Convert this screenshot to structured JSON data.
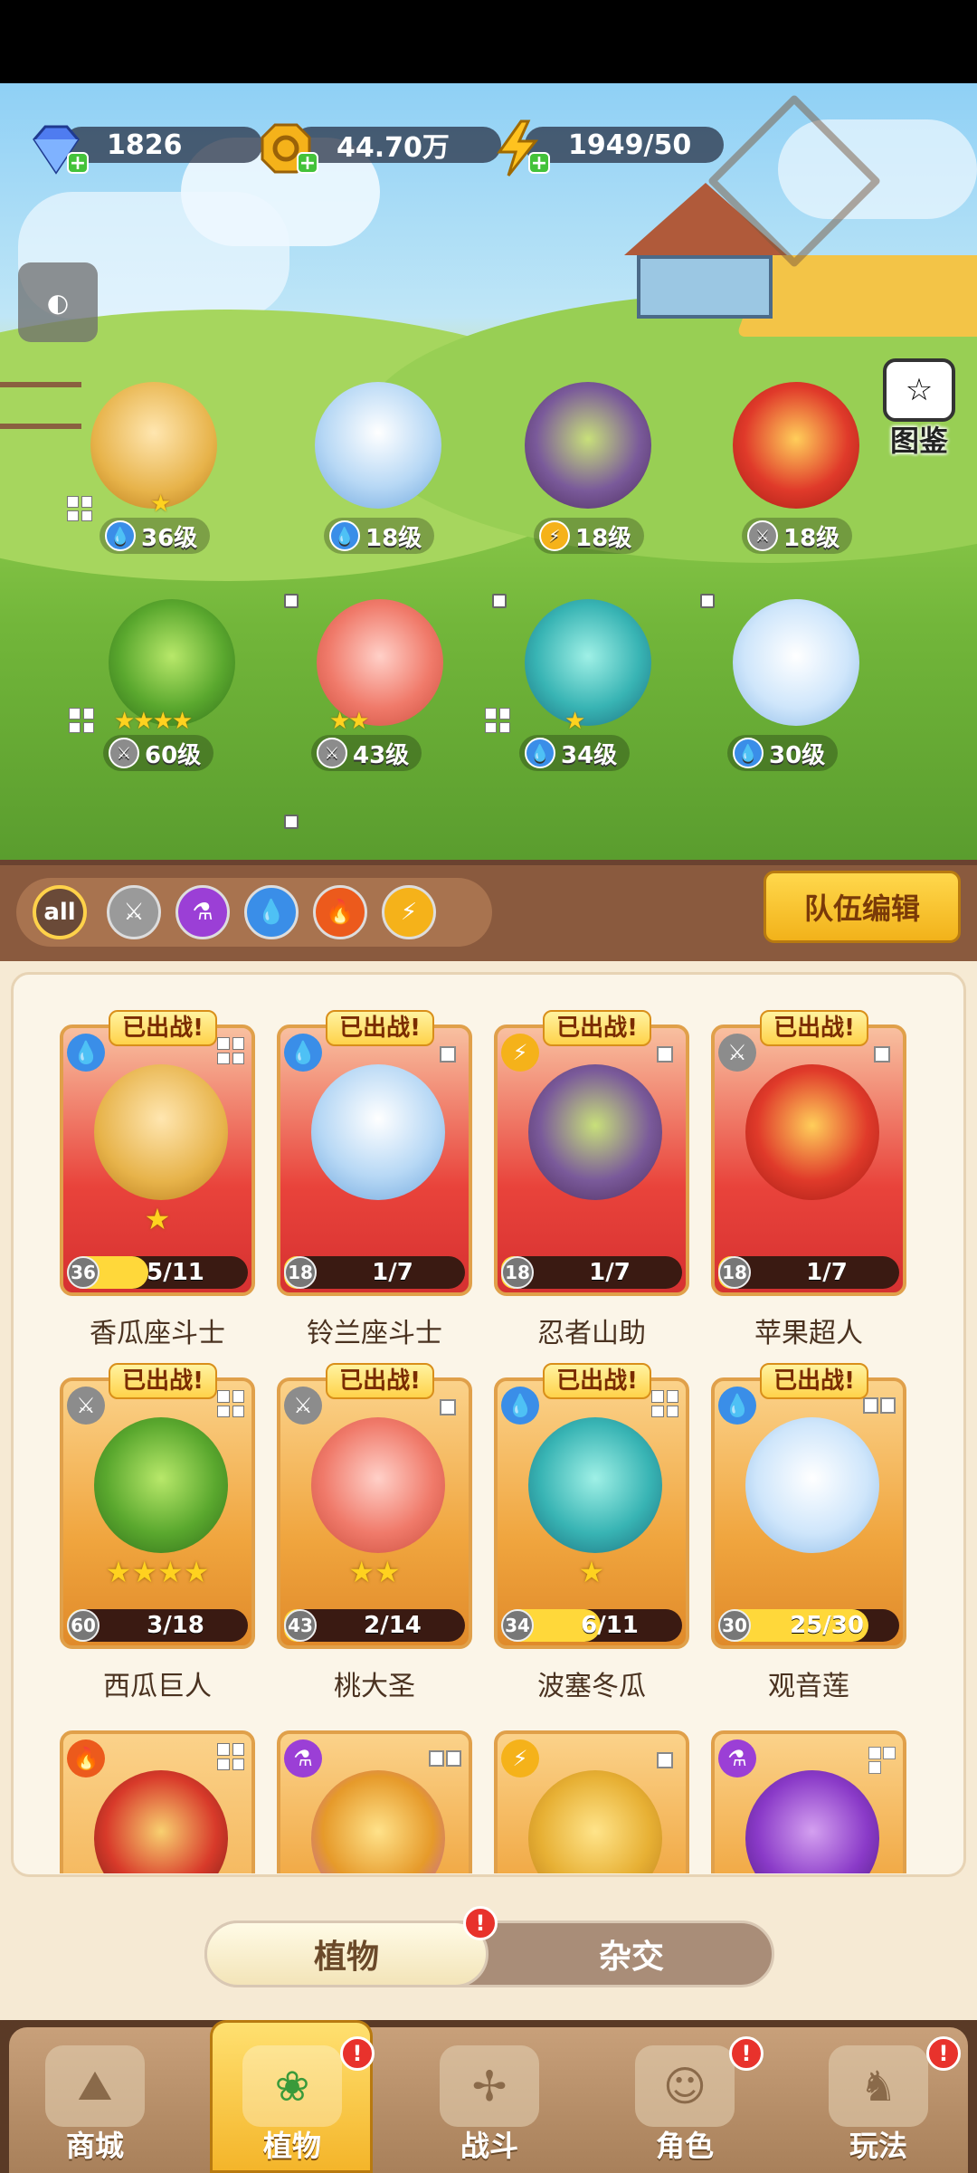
{
  "resources": {
    "gems": "1826",
    "coins": "44.70万",
    "energy": "1949/50"
  },
  "encyclopedia_label": "图鉴",
  "lineup": [
    {
      "level": "36级",
      "element": "water",
      "stars": "★"
    },
    {
      "level": "18级",
      "element": "water",
      "stars": ""
    },
    {
      "level": "18级",
      "element": "thunder",
      "stars": ""
    },
    {
      "level": "18级",
      "element": "sword",
      "stars": ""
    },
    {
      "level": "60级",
      "element": "sword",
      "stars": "★★★★"
    },
    {
      "level": "43级",
      "element": "sword",
      "stars": "★★"
    },
    {
      "level": "34级",
      "element": "water",
      "stars": "★"
    },
    {
      "level": "30级",
      "element": "water",
      "stars": ""
    }
  ],
  "filters": {
    "all_label": "all"
  },
  "team_edit_label": "队伍编辑",
  "deployed_badge": "已出战!",
  "cards": [
    {
      "name": "香瓜座斗士",
      "level": "36",
      "progress": "5/11",
      "progress_fraction": 0.45,
      "stars": "★",
      "frame": "red",
      "element": "water"
    },
    {
      "name": "铃兰座斗士",
      "level": "18",
      "progress": "1/7",
      "progress_fraction": 0.14,
      "stars": "",
      "frame": "red",
      "element": "water"
    },
    {
      "name": "忍者山助",
      "level": "18",
      "progress": "1/7",
      "progress_fraction": 0.14,
      "stars": "",
      "frame": "red",
      "element": "thunder"
    },
    {
      "name": "苹果超人",
      "level": "18",
      "progress": "1/7",
      "progress_fraction": 0.14,
      "stars": "",
      "frame": "red",
      "element": "sword"
    },
    {
      "name": "西瓜巨人",
      "level": "60",
      "progress": "3/18",
      "progress_fraction": 0.17,
      "stars": "★★★★",
      "frame": "gold",
      "element": "sword"
    },
    {
      "name": "桃大圣",
      "level": "43",
      "progress": "2/14",
      "progress_fraction": 0.14,
      "stars": "★★",
      "frame": "gold",
      "element": "sword"
    },
    {
      "name": "波塞冬瓜",
      "level": "34",
      "progress": "6/11",
      "progress_fraction": 0.55,
      "stars": "★",
      "frame": "gold",
      "element": "water"
    },
    {
      "name": "观音莲",
      "level": "30",
      "progress": "25/30",
      "progress_fraction": 0.83,
      "stars": "",
      "frame": "gold",
      "element": "water"
    }
  ],
  "tabs": {
    "plants": "植物",
    "hybrid": "杂交",
    "alert": "!"
  },
  "nav": {
    "shop": "商城",
    "plants": "植物",
    "battle": "战斗",
    "characters": "角色",
    "gameplay": "玩法",
    "alert": "!"
  },
  "colors": {
    "water": "#3a8ee8",
    "thunder": "#f5b21a",
    "sword": "#8c8c8c",
    "poison": "#9b3fd6",
    "fire": "#ec5a1c"
  }
}
